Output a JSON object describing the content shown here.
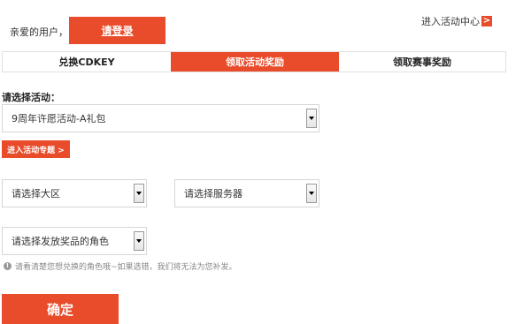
{
  "header": {
    "greeting": "亲爱的用户，",
    "login_label": "请登录",
    "enter_center_label": "进入活动中心",
    "enter_center_icon": "arrow-right-icon"
  },
  "tabs": [
    {
      "label": "兑换CDKEY",
      "active": false
    },
    {
      "label": "领取活动奖励",
      "active": true
    },
    {
      "label": "领取赛事奖励",
      "active": false
    }
  ],
  "form": {
    "activity_label": "请选择活动：",
    "activity_value": "9周年许愿活动-A礼包",
    "topic_button_label": "进入活动专题 >",
    "region_value": "请选择大区",
    "server_value": "请选择服务器",
    "role_value": "请选择发放奖品的角色",
    "notice_text": "请看清楚您想兑换的角色哦~如果选错，我们将无法为您补发。",
    "confirm_label": "确定"
  },
  "colors": {
    "accent": "#e84c2b"
  }
}
